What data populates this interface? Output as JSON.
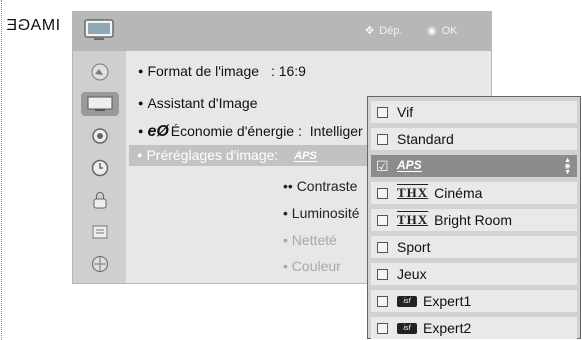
{
  "side_label": "IMAGE",
  "header": {
    "move_hint": "Dép.",
    "ok_hint": "OK",
    "icons": {
      "tv": "tv-icon",
      "move": "dpad-icon",
      "ok": "ok-button-icon"
    }
  },
  "sidebar": {
    "items": [
      {
        "icon": "picture-icon",
        "active": false
      },
      {
        "icon": "screen-icon",
        "active": true
      },
      {
        "icon": "sound-icon",
        "active": false
      },
      {
        "icon": "clock-icon",
        "active": false
      },
      {
        "icon": "lock-icon",
        "active": false
      },
      {
        "icon": "option-icon",
        "active": false
      },
      {
        "icon": "network-icon",
        "active": false
      }
    ]
  },
  "menu": {
    "format_label": "Format de l'image",
    "format_value": ": 16:9",
    "assistant_label": "Assistant d'Image",
    "eco_glyph": "eØ",
    "eco_label": "Économie d'énergie :",
    "eco_value": "Intelliger",
    "presets_label": "Préréglages d'image:",
    "presets_logo": "APS",
    "sub_items": {
      "contrast": "•• Contraste",
      "brightness": "• Luminosité",
      "sharpness": "• Netteté",
      "color": "• Couleur"
    }
  },
  "dropdown": {
    "options": [
      {
        "label": "Vif",
        "prefix": ""
      },
      {
        "label": "Standard",
        "prefix": ""
      },
      {
        "label": "",
        "prefix": "APS"
      },
      {
        "label": "Cinéma",
        "prefix": "THX"
      },
      {
        "label": "Bright Room",
        "prefix": "THX"
      },
      {
        "label": "Sport",
        "prefix": ""
      },
      {
        "label": "Jeux",
        "prefix": ""
      },
      {
        "label": "Expert1",
        "prefix": "isf"
      },
      {
        "label": "Expert2",
        "prefix": "isf"
      }
    ],
    "selected_index": 2
  },
  "colors": {
    "header_bg": "#b7b7b7",
    "panel_bg": "#e7e7e7",
    "selected_bg": "#8c8c8c"
  }
}
